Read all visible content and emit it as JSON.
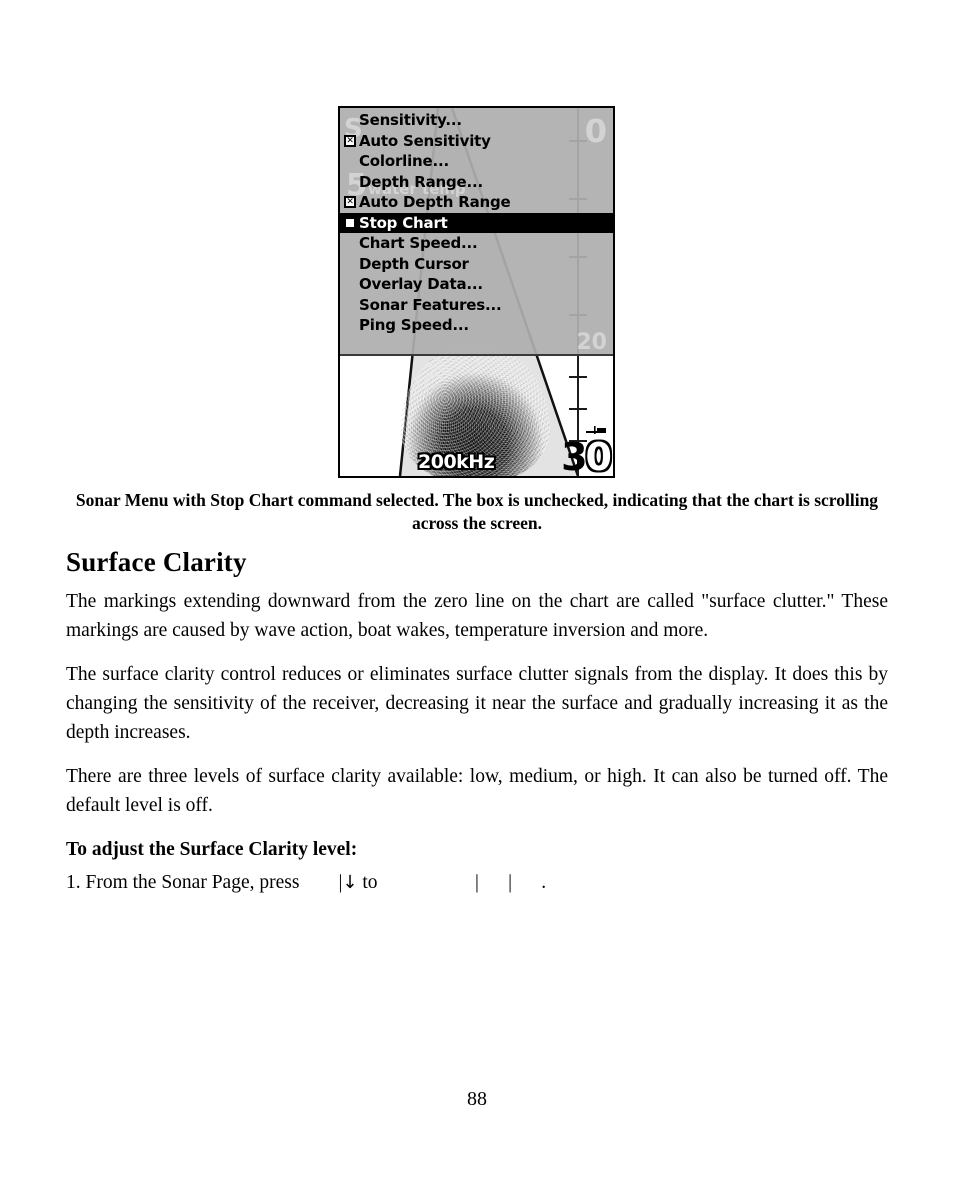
{
  "figure": {
    "device_screen": {
      "menu": {
        "items": [
          {
            "label": "Sensitivity...",
            "checkbox": "none",
            "selected": false
          },
          {
            "label": "Auto Sensitivity",
            "checkbox": "checked",
            "selected": false
          },
          {
            "label": "Colorline...",
            "checkbox": "none",
            "selected": false
          },
          {
            "label": "Depth Range...",
            "checkbox": "none",
            "selected": false
          },
          {
            "label": "Auto Depth Range",
            "checkbox": "checked",
            "selected": false
          },
          {
            "label": "Stop Chart",
            "checkbox": "unchecked",
            "selected": true
          },
          {
            "label": "Chart Speed...",
            "checkbox": "none",
            "selected": false
          },
          {
            "label": "Depth Cursor",
            "checkbox": "none",
            "selected": false
          },
          {
            "label": "Overlay Data...",
            "checkbox": "none",
            "selected": false
          },
          {
            "label": "Sonar Features...",
            "checkbox": "none",
            "selected": false
          },
          {
            "label": "Ping Speed...",
            "checkbox": "none",
            "selected": false
          }
        ]
      },
      "sonar": {
        "frequency_label": "200kHz",
        "depth_readout_main": "3",
        "depth_readout_last": "0",
        "ghost_scale_top": "0",
        "ghost_scale_mid": "20",
        "ghost_scale_left": "5",
        "ghost_surface_text": "S",
        "ghost_temp_text": "water temp"
      }
    },
    "caption": "Sonar Menu with Stop Chart command selected. The box is unchecked, indicating that the chart is scrolling across the screen."
  },
  "content": {
    "section_title": "Surface Clarity",
    "paragraphs": [
      "The markings extending downward from the zero line on the chart are called \"surface clutter.\" These markings are caused by wave action, boat wakes, temperature inversion and more.",
      "The surface clarity control reduces or eliminates surface clutter signals from the display. It does this by changing the sensitivity of the receiver, decreasing it near the surface and gradually increasing it as the depth increases.",
      "There are three levels of surface clarity available: low, medium, or high. It can also be turned off. The default level is off."
    ],
    "instruction_heading": "To adjust the Surface Clarity level:",
    "step": {
      "prefix": "1. From the Sonar Page, press",
      "gap_one": "        ",
      "bar_one": "|",
      "arrow": "↓",
      "middle": " to",
      "gap_two": "                    ",
      "bar_two": "|",
      "gap_three": "      ",
      "bar_three": "|",
      "gap_four": "      ",
      "period": "."
    }
  },
  "page_number": "88"
}
